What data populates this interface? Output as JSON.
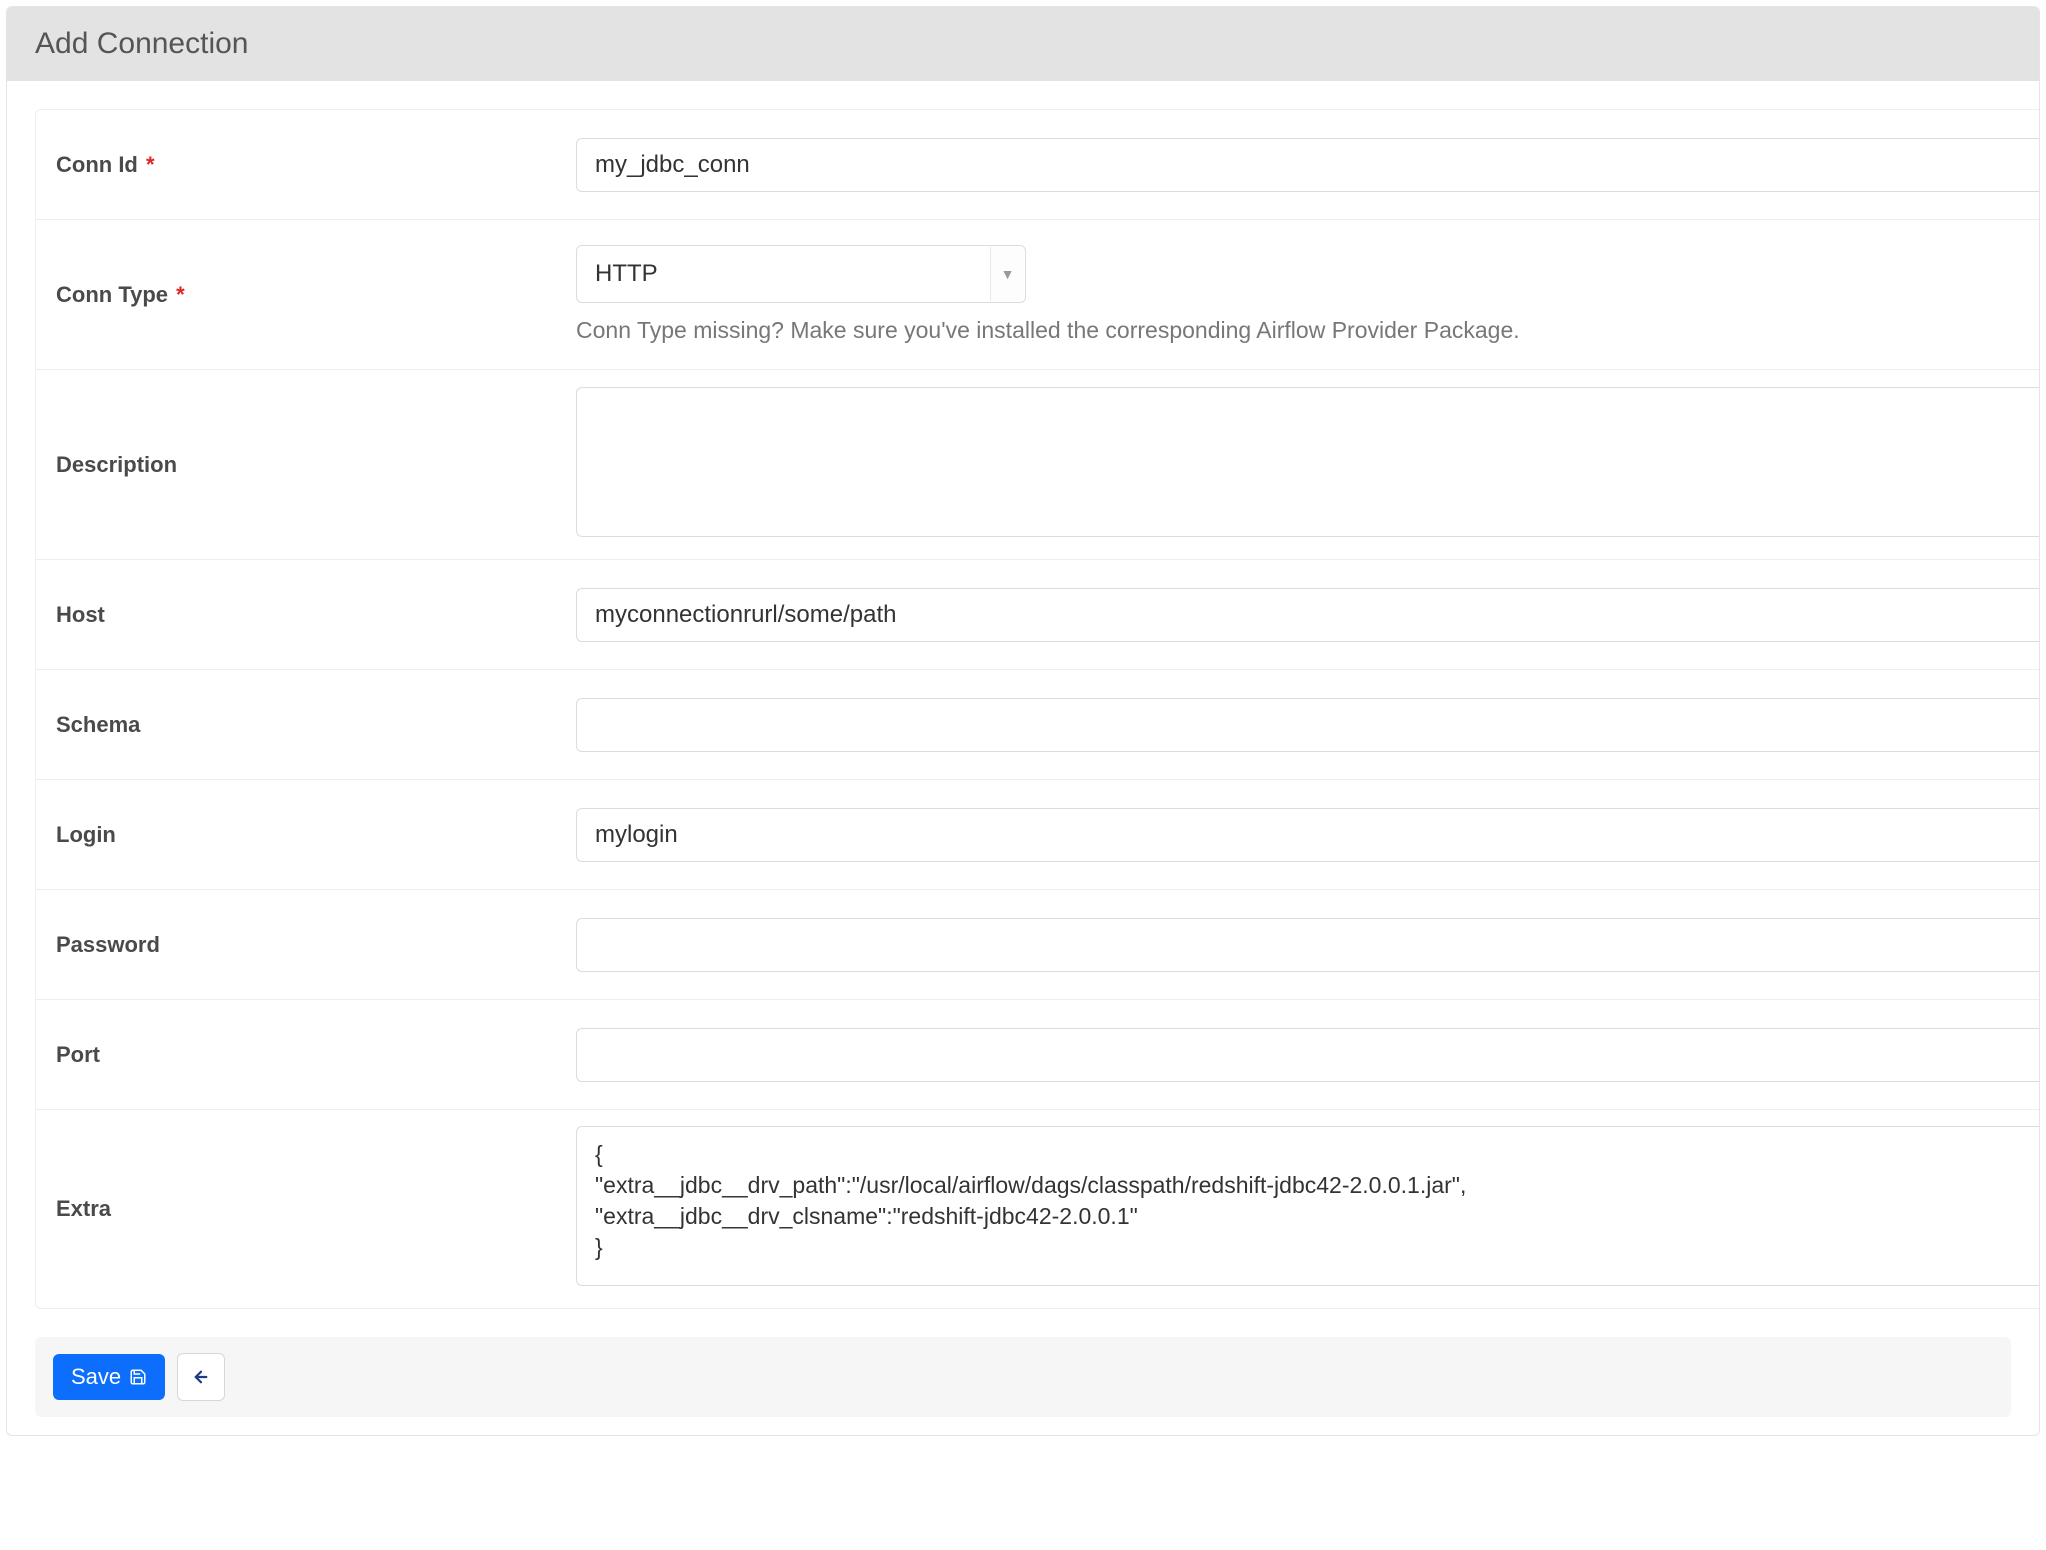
{
  "header": {
    "title": "Add Connection"
  },
  "form": {
    "conn_id": {
      "label": "Conn Id",
      "required": true,
      "value": "my_jdbc_conn"
    },
    "conn_type": {
      "label": "Conn Type",
      "required": true,
      "value": "HTTP",
      "help": "Conn Type missing? Make sure you've installed the corresponding Airflow Provider Package."
    },
    "description": {
      "label": "Description",
      "required": false,
      "value": ""
    },
    "host": {
      "label": "Host",
      "required": false,
      "value": "myconnectionrurl/some/path"
    },
    "schema": {
      "label": "Schema",
      "required": false,
      "value": ""
    },
    "login": {
      "label": "Login",
      "required": false,
      "value": "mylogin"
    },
    "password": {
      "label": "Password",
      "required": false,
      "value": ""
    },
    "port": {
      "label": "Port",
      "required": false,
      "value": ""
    },
    "extra": {
      "label": "Extra",
      "required": false,
      "value": "{\n\"extra__jdbc__drv_path\":\"/usr/local/airflow/dags/classpath/redshift-jdbc42-2.0.0.1.jar\",\n\"extra__jdbc__drv_clsname\":\"redshift-jdbc42-2.0.0.1\"\n}"
    }
  },
  "footer": {
    "save_label": "Save",
    "save_icon": "save-icon",
    "back_icon": "arrow-left-icon"
  },
  "required_marker": "*"
}
